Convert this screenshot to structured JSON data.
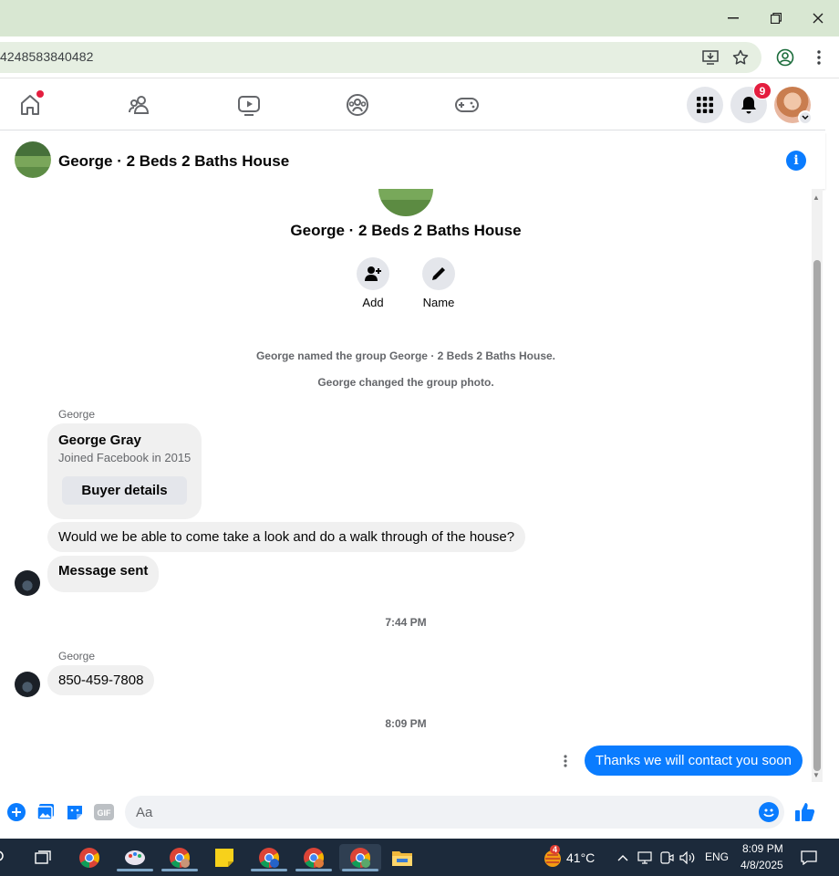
{
  "browser": {
    "url_fragment": "4248583840482"
  },
  "nav": {
    "notification_count": "9"
  },
  "chat": {
    "title": "George · 2 Beds 2 Baths House",
    "group_name": "George · 2 Beds 2 Baths House",
    "actions": [
      {
        "label": "Add",
        "icon": "add-person-icon"
      },
      {
        "label": "Name",
        "icon": "pencil-icon"
      }
    ],
    "system_messages": [
      "George named the group George · 2 Beds 2 Baths House.",
      "George changed the group photo."
    ],
    "card": {
      "sender": "George",
      "name": "George Gray",
      "subtitle": "Joined Facebook in 2015",
      "button": "Buyer details"
    },
    "messages": [
      {
        "text": "Would we be able to come take a look and do a walk through of the house?"
      },
      {
        "text": "Message sent"
      }
    ],
    "time1": "7:44 PM",
    "sender2": "George",
    "phone_message": "850-459-7808",
    "time2": "8:09 PM",
    "outgoing": "Thanks we will contact you soon",
    "composer_placeholder": "Aa"
  },
  "taskbar": {
    "weather_badge": "4",
    "temperature": "41°C",
    "language": "ENG",
    "time": "8:09 PM",
    "date": "4/8/2025"
  },
  "colors": {
    "messenger_blue": "#0a7cff",
    "badge_red": "#e41e3f",
    "browser_frame": "#d8e7d2",
    "taskbar": "#1c2a3b"
  }
}
